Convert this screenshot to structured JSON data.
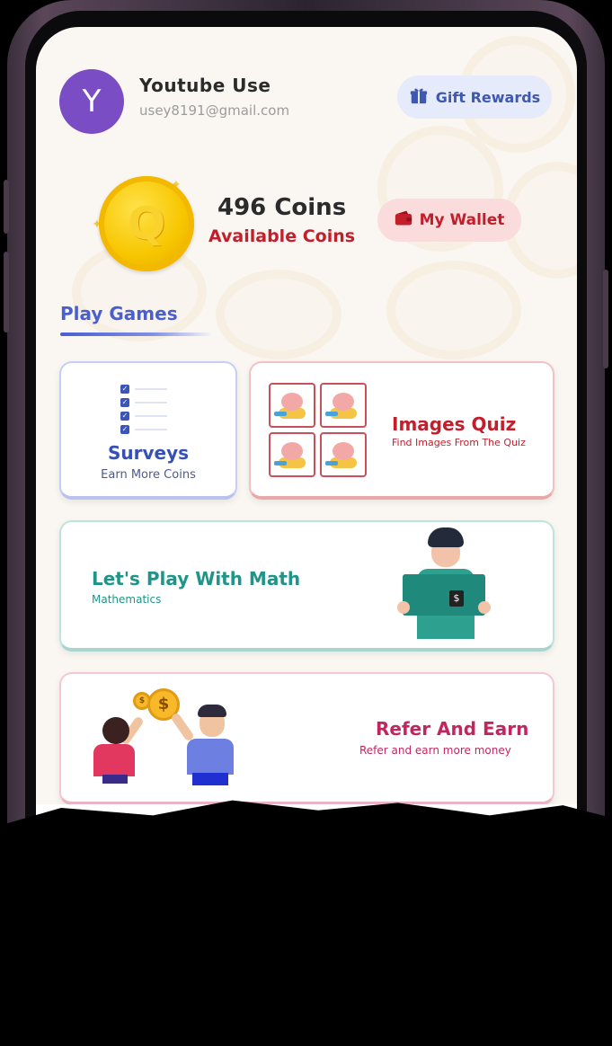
{
  "user": {
    "avatar_initial": "Y",
    "name": "Youtube Use",
    "email": "usey8191@gmail.com"
  },
  "header": {
    "gift_rewards_label": "Gift Rewards",
    "gift_icon": "gift-icon"
  },
  "balance": {
    "coin_letter": "Q",
    "coins_count": "496 Coins",
    "coins_label": "Available Coins",
    "wallet_label": "My Wallet",
    "wallet_icon": "wallet-icon"
  },
  "section": {
    "title": "Play Games"
  },
  "cards": {
    "surveys": {
      "title": "Surveys",
      "subtitle": "Earn More Coins"
    },
    "images_quiz": {
      "title": "Images Quiz",
      "subtitle": "Find Images From The Quiz"
    },
    "math": {
      "title": "Let's Play With Math",
      "subtitle": "Mathematics",
      "book_symbol": "$"
    },
    "refer": {
      "title": "Refer And Earn",
      "subtitle": "Refer and earn more money",
      "coin_symbol": "$"
    }
  },
  "colors": {
    "avatar": "#7b4dc4",
    "primary_blue": "#4a5fcf",
    "accent_red": "#c21e2c",
    "teal": "#1f9488",
    "pink": "#c3265f",
    "coin_gold": "#f7c600"
  }
}
